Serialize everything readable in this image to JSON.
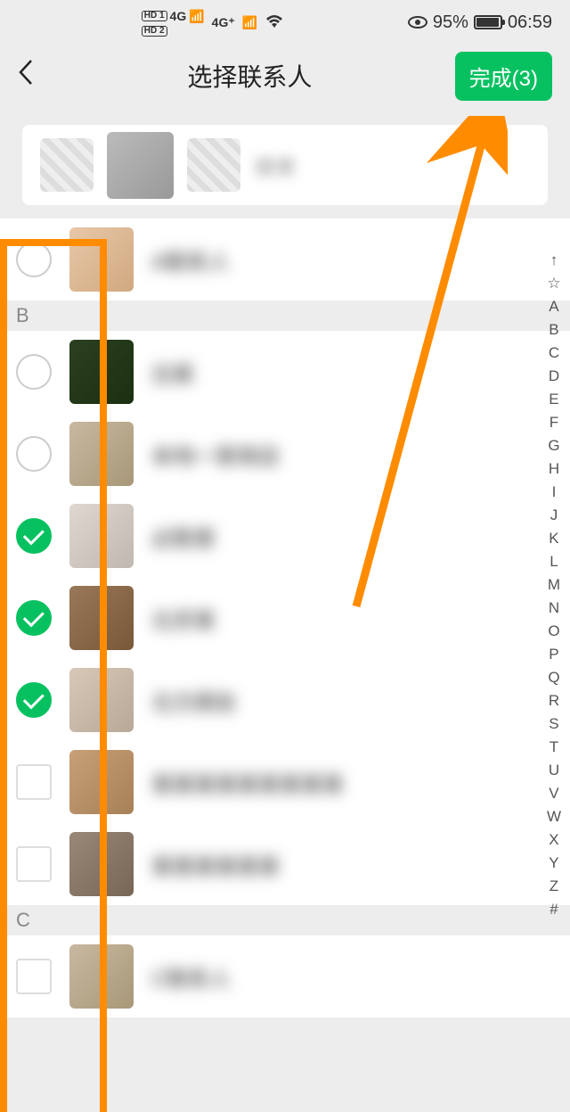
{
  "status_bar": {
    "hd1": "HD 1",
    "hd2": "HD 2",
    "sig1": "4G",
    "sig2": "4G⁺",
    "battery_pct": "95%",
    "time": "06:59"
  },
  "header": {
    "title": "选择联系人",
    "done_label": "完成(3)"
  },
  "search": {
    "placeholder": "搜索"
  },
  "sections": [
    {
      "id": "A_partial",
      "label": "",
      "contacts": [
        {
          "name": "A联系人",
          "checked": false,
          "avatar": "avatar-a1"
        }
      ]
    },
    {
      "id": "B",
      "label": "B",
      "contacts": [
        {
          "name": "白某",
          "checked": false,
          "avatar": "avatar-b1"
        },
        {
          "name": "本地一家商店",
          "checked": false,
          "avatar": "avatar-b2"
        },
        {
          "name": "必胜客",
          "checked": true,
          "avatar": "avatar-b3"
        },
        {
          "name": "北京某",
          "checked": true,
          "avatar": "avatar-b4"
        },
        {
          "name": "北方朋友",
          "checked": true,
          "avatar": "avatar-b5"
        },
        {
          "name": "某某某某某某某某某",
          "checked": false,
          "avatar": "avatar-b6",
          "shape": "square"
        },
        {
          "name": "某某某某某某",
          "checked": false,
          "avatar": "avatar-b7",
          "shape": "square"
        }
      ]
    },
    {
      "id": "C",
      "label": "C",
      "contacts": [
        {
          "name": "C联系人",
          "checked": false,
          "avatar": "avatar-b2",
          "shape": "square"
        }
      ]
    }
  ],
  "index_bar": [
    "↑",
    "☆",
    "A",
    "B",
    "C",
    "D",
    "E",
    "F",
    "G",
    "H",
    "I",
    "J",
    "K",
    "L",
    "M",
    "N",
    "O",
    "P",
    "Q",
    "R",
    "S",
    "T",
    "U",
    "V",
    "W",
    "X",
    "Y",
    "Z",
    "#"
  ],
  "selected_count": 3,
  "colors": {
    "primary": "#07c160",
    "annotation": "#ff8c00"
  }
}
